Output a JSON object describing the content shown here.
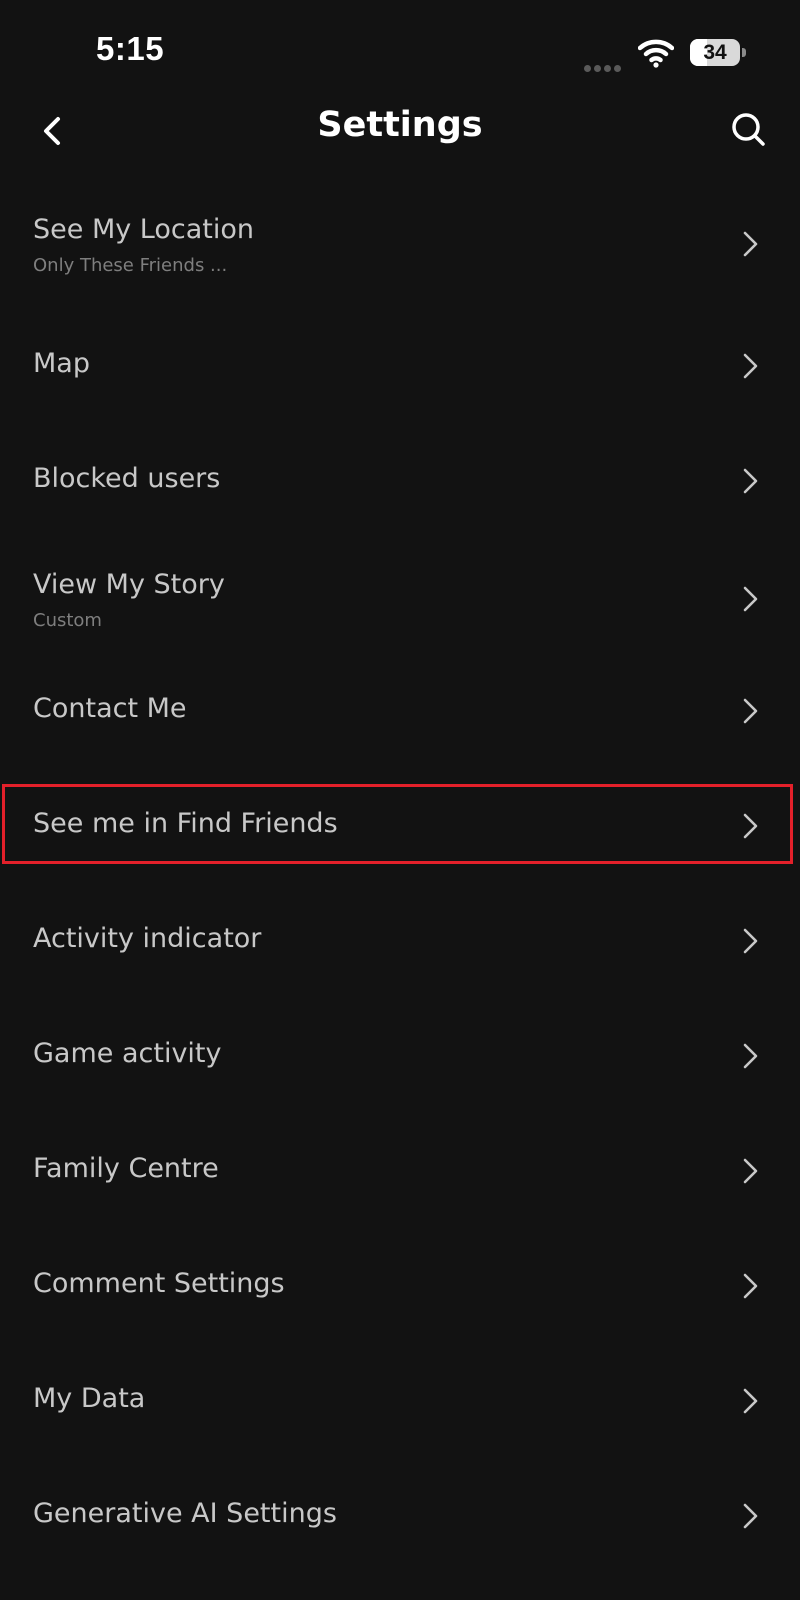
{
  "status_bar": {
    "time": "5:15",
    "battery_level": "34",
    "battery_fraction": 0.34
  },
  "header": {
    "title": "Settings",
    "back_icon": "chevron-left-icon",
    "search_icon": "search-icon"
  },
  "settings": {
    "items": [
      {
        "label": "See My Location",
        "sublabel": "Only These Friends ..."
      },
      {
        "label": "Map",
        "sublabel": ""
      },
      {
        "label": "Blocked users",
        "sublabel": ""
      },
      {
        "label": "View My Story",
        "sublabel": "Custom"
      },
      {
        "label": "Contact Me",
        "sublabel": ""
      },
      {
        "label": "See me in Find Friends",
        "sublabel": ""
      },
      {
        "label": "Activity indicator",
        "sublabel": ""
      },
      {
        "label": "Game activity",
        "sublabel": ""
      },
      {
        "label": "Family Centre",
        "sublabel": ""
      },
      {
        "label": "Comment Settings",
        "sublabel": ""
      },
      {
        "label": "My Data",
        "sublabel": ""
      },
      {
        "label": "Generative AI Settings",
        "sublabel": ""
      }
    ],
    "highlighted_item": "See me in Find Friends"
  },
  "colors": {
    "background": "#121212",
    "title": "#ffffff",
    "label": "#c8c8c8",
    "sublabel": "#7e7e7e",
    "highlight": "#e3202a"
  }
}
